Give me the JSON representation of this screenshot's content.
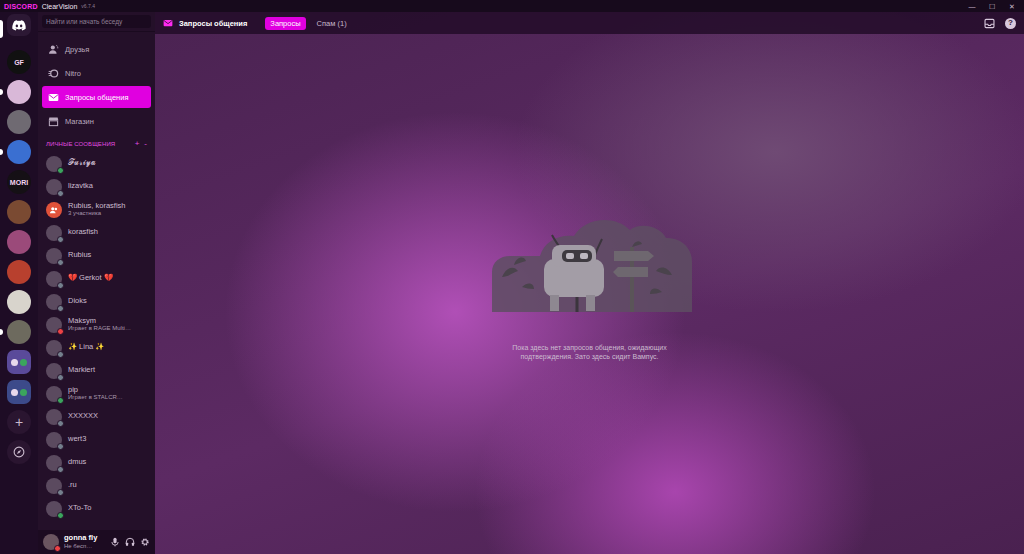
{
  "window": {
    "brand": "DISCORD",
    "title": "ClearVision",
    "version": "v6.7.4",
    "controls": [
      "—",
      "☐",
      "✕"
    ]
  },
  "servers": [
    {
      "kind": "home",
      "label": "",
      "color": "#2c1834",
      "selected": true,
      "unread": false
    },
    {
      "kind": "text",
      "label": "GF",
      "color": "#111111",
      "selected": false,
      "unread": false
    },
    {
      "kind": "image",
      "label": "",
      "color": "#d9b8d8",
      "selected": false,
      "unread": true
    },
    {
      "kind": "image",
      "label": "",
      "color": "#6f6a72",
      "selected": false,
      "unread": false
    },
    {
      "kind": "image",
      "label": "",
      "color": "#3a6fd1",
      "selected": false,
      "unread": true
    },
    {
      "kind": "text",
      "label": "MORI",
      "color": "#151015",
      "selected": false,
      "unread": false
    },
    {
      "kind": "image",
      "label": "",
      "color": "#7a4a32",
      "selected": false,
      "unread": false
    },
    {
      "kind": "image",
      "label": "",
      "color": "#9b4a7a",
      "selected": false,
      "unread": false
    },
    {
      "kind": "image",
      "label": "",
      "color": "#b8402e",
      "selected": false,
      "unread": false
    },
    {
      "kind": "image",
      "label": "",
      "color": "#d8d4cc",
      "selected": false,
      "unread": false
    },
    {
      "kind": "image",
      "label": "",
      "color": "#6d6a5e",
      "selected": false,
      "unread": true
    },
    {
      "kind": "folder",
      "label": "",
      "color": "#5a4a9a",
      "selected": false,
      "unread": false
    },
    {
      "kind": "folder",
      "label": "",
      "color": "#3c4a8a",
      "selected": false,
      "unread": false
    }
  ],
  "server_actions": [
    {
      "kind": "add",
      "label": "+"
    },
    {
      "kind": "explore",
      "label": ""
    }
  ],
  "search": {
    "placeholder": "Найти или начать беседу"
  },
  "nav": [
    {
      "kind": "friends",
      "label": "Друзья",
      "selected": false
    },
    {
      "kind": "nitro",
      "label": "Nitro",
      "selected": false
    },
    {
      "kind": "requests",
      "label": "Запросы общения",
      "selected": true
    },
    {
      "kind": "shop",
      "label": "Магазин",
      "selected": false
    }
  ],
  "dm_header": {
    "label": "ЛИЧНЫЕ СООБЩЕНИЯ",
    "buttons": [
      "+",
      "-"
    ]
  },
  "dms": [
    {
      "kind": "user",
      "name": "𝓕𝓾𝓻𝓲𝔂𝓪",
      "subtitle": "",
      "color": "#3ba55d"
    },
    {
      "kind": "user",
      "name": "lizavtka",
      "subtitle": "",
      "color": "#747f8d"
    },
    {
      "kind": "group",
      "name": "Rubius, korasfish",
      "subtitle": "3 участника",
      "color": "#e0523a"
    },
    {
      "kind": "user",
      "name": "korasfish",
      "subtitle": "",
      "color": "#747f8d"
    },
    {
      "kind": "user",
      "name": "Rubius",
      "subtitle": "",
      "color": "#747f8d"
    },
    {
      "kind": "user",
      "name": "💔 Gerkot 💔",
      "subtitle": "",
      "color": "#747f8d"
    },
    {
      "kind": "user",
      "name": "Dioks",
      "subtitle": "",
      "color": "#747f8d"
    },
    {
      "kind": "user",
      "name": "Maksym",
      "subtitle": "Играет в RAGE Multi…",
      "color": "#ed4245"
    },
    {
      "kind": "user",
      "name": "✨ Lina ✨",
      "subtitle": "",
      "color": "#747f8d"
    },
    {
      "kind": "user",
      "name": "Markiert",
      "subtitle": "",
      "color": "#747f8d"
    },
    {
      "kind": "user",
      "name": "pip",
      "subtitle": "Играет в STALCR…",
      "color": "#3ba55d"
    },
    {
      "kind": "user",
      "name": "XXXXXX",
      "subtitle": "",
      "color": "#747f8d"
    },
    {
      "kind": "user",
      "name": "wert3",
      "subtitle": "",
      "color": "#747f8d"
    },
    {
      "kind": "user",
      "name": "dmus",
      "subtitle": "",
      "color": "#747f8d"
    },
    {
      "kind": "user",
      "name": ".ru",
      "subtitle": "",
      "color": "#747f8d"
    },
    {
      "kind": "user",
      "name": "XTo-To",
      "subtitle": "",
      "color": "#3ba55d"
    }
  ],
  "user": {
    "name": "gonna fly",
    "status": "Не бесп…",
    "color": "#ed4245"
  },
  "header": {
    "title": "Запросы общения",
    "tabs": [
      {
        "label": "Запросы",
        "selected": true
      },
      {
        "label": "Спам (1)",
        "selected": false
      }
    ],
    "help": "?"
  },
  "empty_state": {
    "text": "Пока здесь нет запросов общения, ожидающих подтверждения. Зато здесь сидит Вампус."
  }
}
